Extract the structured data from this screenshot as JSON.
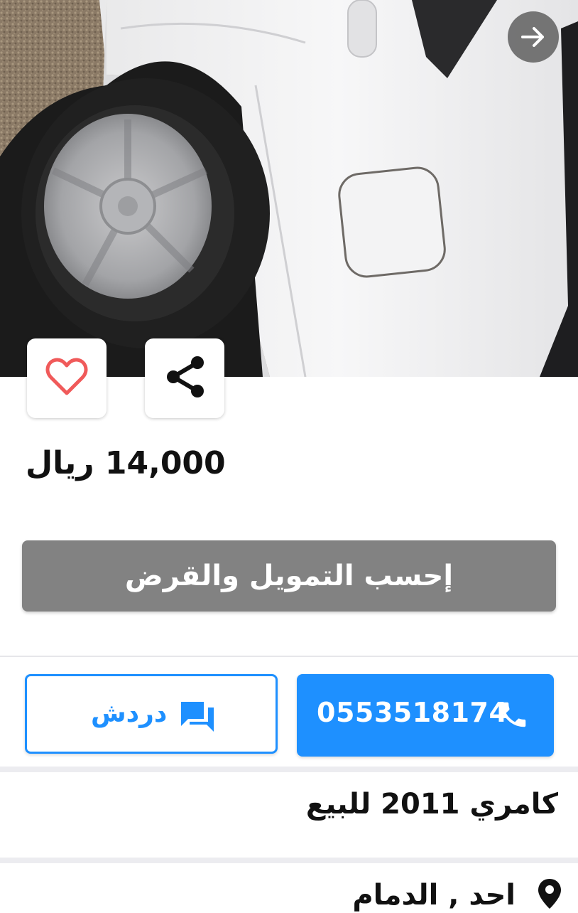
{
  "listing": {
    "price": "14,000 ريال",
    "title": "كامري 2011 للبيع",
    "location": "احد , الدمام"
  },
  "actions": {
    "finance_label": "إحسب التمويل والقرض",
    "chat_label": "دردش",
    "phone_number": "0553518174"
  },
  "icons": {
    "back": "arrow-right-icon",
    "favorite": "heart-outline-icon",
    "share": "share-icon",
    "chat": "chat-bubble-icon",
    "phone": "phone-icon",
    "location": "map-pin-icon"
  },
  "colors": {
    "accent": "#1e90ff",
    "finance_button": "#828282",
    "heart": "#f05a5a"
  }
}
